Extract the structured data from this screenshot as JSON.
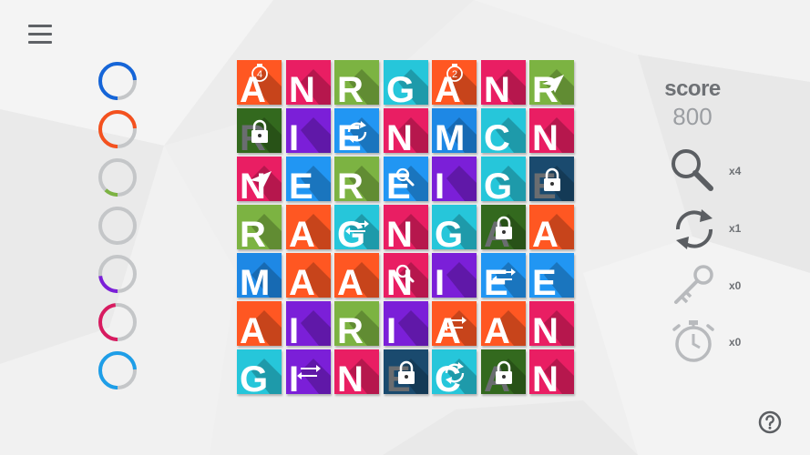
{
  "menu": {
    "icon": "hamburger-menu-icon"
  },
  "rings": [
    {
      "color": "#1565d8",
      "fraction": 0.74
    },
    {
      "color": "#f4511e",
      "fraction": 0.74
    },
    {
      "color": "#7cb342",
      "fraction": 0.12
    },
    {
      "color": "#2ab0c8",
      "fraction": 0.0
    },
    {
      "color": "#7b1fd8",
      "fraction": 0.23
    },
    {
      "color": "#d81b60",
      "fraction": 0.48
    },
    {
      "color": "#1e9ee8",
      "fraction": 0.74
    }
  ],
  "colors": {
    "O": "#ff5722",
    "M": "#e91e63",
    "G": "#7cb342",
    "C": "#26c6da",
    "P": "#8e24aa",
    "V": "#7b1fd8",
    "B": "#1e88e5",
    "D": "#33691e",
    "Y": "#2196f3",
    "N": "#1a4a6e"
  },
  "board": [
    [
      {
        "c": "O",
        "l": "A",
        "i": "timer-4-icon"
      },
      {
        "c": "M",
        "l": "N"
      },
      {
        "c": "G",
        "l": "R"
      },
      {
        "c": "C",
        "l": "G"
      },
      {
        "c": "O",
        "l": "A",
        "i": "timer-2-icon"
      },
      {
        "c": "M",
        "l": "N"
      },
      {
        "c": "G",
        "l": "R",
        "i": "paper-plane-icon"
      }
    ],
    [
      {
        "c": "D",
        "l": "R",
        "i": "lock-icon"
      },
      {
        "c": "V",
        "l": "I"
      },
      {
        "c": "Y",
        "l": "E",
        "i": "refresh-icon"
      },
      {
        "c": "M",
        "l": "N"
      },
      {
        "c": "B",
        "l": "M"
      },
      {
        "c": "C",
        "l": "C"
      },
      {
        "c": "M",
        "l": "N"
      }
    ],
    [
      {
        "c": "M",
        "l": "N",
        "i": "paper-plane-icon"
      },
      {
        "c": "Y",
        "l": "E"
      },
      {
        "c": "G",
        "l": "R"
      },
      {
        "c": "Y",
        "l": "E",
        "i": "magnifier-icon"
      },
      {
        "c": "V",
        "l": "I"
      },
      {
        "c": "C",
        "l": "G"
      },
      {
        "c": "N",
        "l": "E",
        "i": "lock-icon"
      }
    ],
    [
      {
        "c": "G",
        "l": "R"
      },
      {
        "c": "O",
        "l": "A"
      },
      {
        "c": "C",
        "l": "G",
        "i": "swap-icon"
      },
      {
        "c": "M",
        "l": "N"
      },
      {
        "c": "C",
        "l": "G"
      },
      {
        "c": "D",
        "l": "A",
        "i": "lock-icon"
      },
      {
        "c": "O",
        "l": "A"
      }
    ],
    [
      {
        "c": "B",
        "l": "M"
      },
      {
        "c": "O",
        "l": "A"
      },
      {
        "c": "O",
        "l": "A"
      },
      {
        "c": "M",
        "l": "N",
        "i": "magnifier-icon"
      },
      {
        "c": "V",
        "l": "I"
      },
      {
        "c": "Y",
        "l": "E",
        "i": "swap-icon"
      },
      {
        "c": "Y",
        "l": "E"
      }
    ],
    [
      {
        "c": "O",
        "l": "A"
      },
      {
        "c": "V",
        "l": "I"
      },
      {
        "c": "G",
        "l": "R"
      },
      {
        "c": "V",
        "l": "I"
      },
      {
        "c": "O",
        "l": "A",
        "i": "swap-icon"
      },
      {
        "c": "O",
        "l": "A"
      },
      {
        "c": "M",
        "l": "N"
      }
    ],
    [
      {
        "c": "C",
        "l": "G"
      },
      {
        "c": "V",
        "l": "I",
        "i": "swap-icon"
      },
      {
        "c": "M",
        "l": "N"
      },
      {
        "c": "N",
        "l": "E",
        "i": "lock-icon"
      },
      {
        "c": "C",
        "l": "C",
        "i": "refresh-icon"
      },
      {
        "c": "D",
        "l": "A",
        "i": "lock-icon"
      },
      {
        "c": "M",
        "l": "N"
      }
    ]
  ],
  "badges": {
    "timer-4-icon": "4",
    "timer-2-icon": "2"
  },
  "score": {
    "label": "score",
    "value": "800"
  },
  "powerups": [
    {
      "name": "magnifier",
      "icon": "magnifier-icon",
      "count": "x4",
      "enabled": true
    },
    {
      "name": "refresh",
      "icon": "refresh-icon",
      "count": "x1",
      "enabled": true
    },
    {
      "name": "key",
      "icon": "key-icon",
      "count": "x0",
      "enabled": false
    },
    {
      "name": "stopwatch",
      "icon": "stopwatch-icon",
      "count": "x0",
      "enabled": false
    }
  ],
  "help": {
    "icon": "help-icon"
  }
}
